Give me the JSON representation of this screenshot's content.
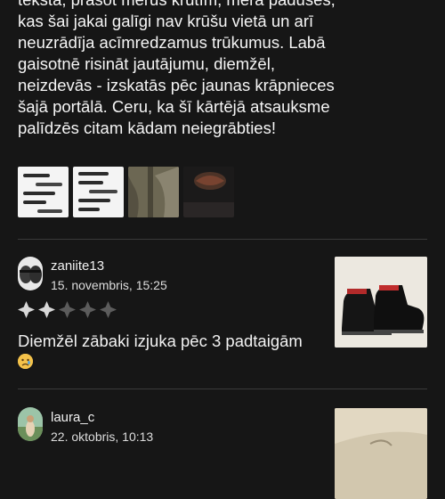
{
  "review": {
    "text": "teksta, prasot mērus krūtīm, mēra padušes, kas šai jakai galīgi nav krūšu vietā un arī neuzrādīja acīmredzamus trūkumus. Labā gaisotnē risināt jautājumu, diemžēl, neizdevās - izskatās pēc jaunas krāpnieces šajā portālā. Ceru, ka šī kārtējā atsauksme palīdzēs citam kādam neiegrābties!",
    "photos": [
      {
        "icon": "chat-screenshot-image"
      },
      {
        "icon": "chat-screenshot-image"
      },
      {
        "icon": "jacket-photo-image"
      },
      {
        "icon": "jacket-embroidery-image"
      }
    ]
  },
  "comments": [
    {
      "username": "zaniite13",
      "date": "15. novembris, 15:25",
      "rating": 2,
      "max_rating": 5,
      "text": "Diemžēl zābaki izjuka pēc 3 padtaigām",
      "emoji": "crying-face-emoji",
      "product_photo": "boots-photo-image"
    },
    {
      "username": "laura_c",
      "date": "22. oktobris, 10:13",
      "product_photo": "item-photo-image"
    }
  ],
  "colors": {
    "background": "#161616",
    "text": "#f2f2f2",
    "star_filled": "#d8d8d8",
    "star_empty": "#5c5c5c",
    "divider": "#3a3a3a"
  }
}
